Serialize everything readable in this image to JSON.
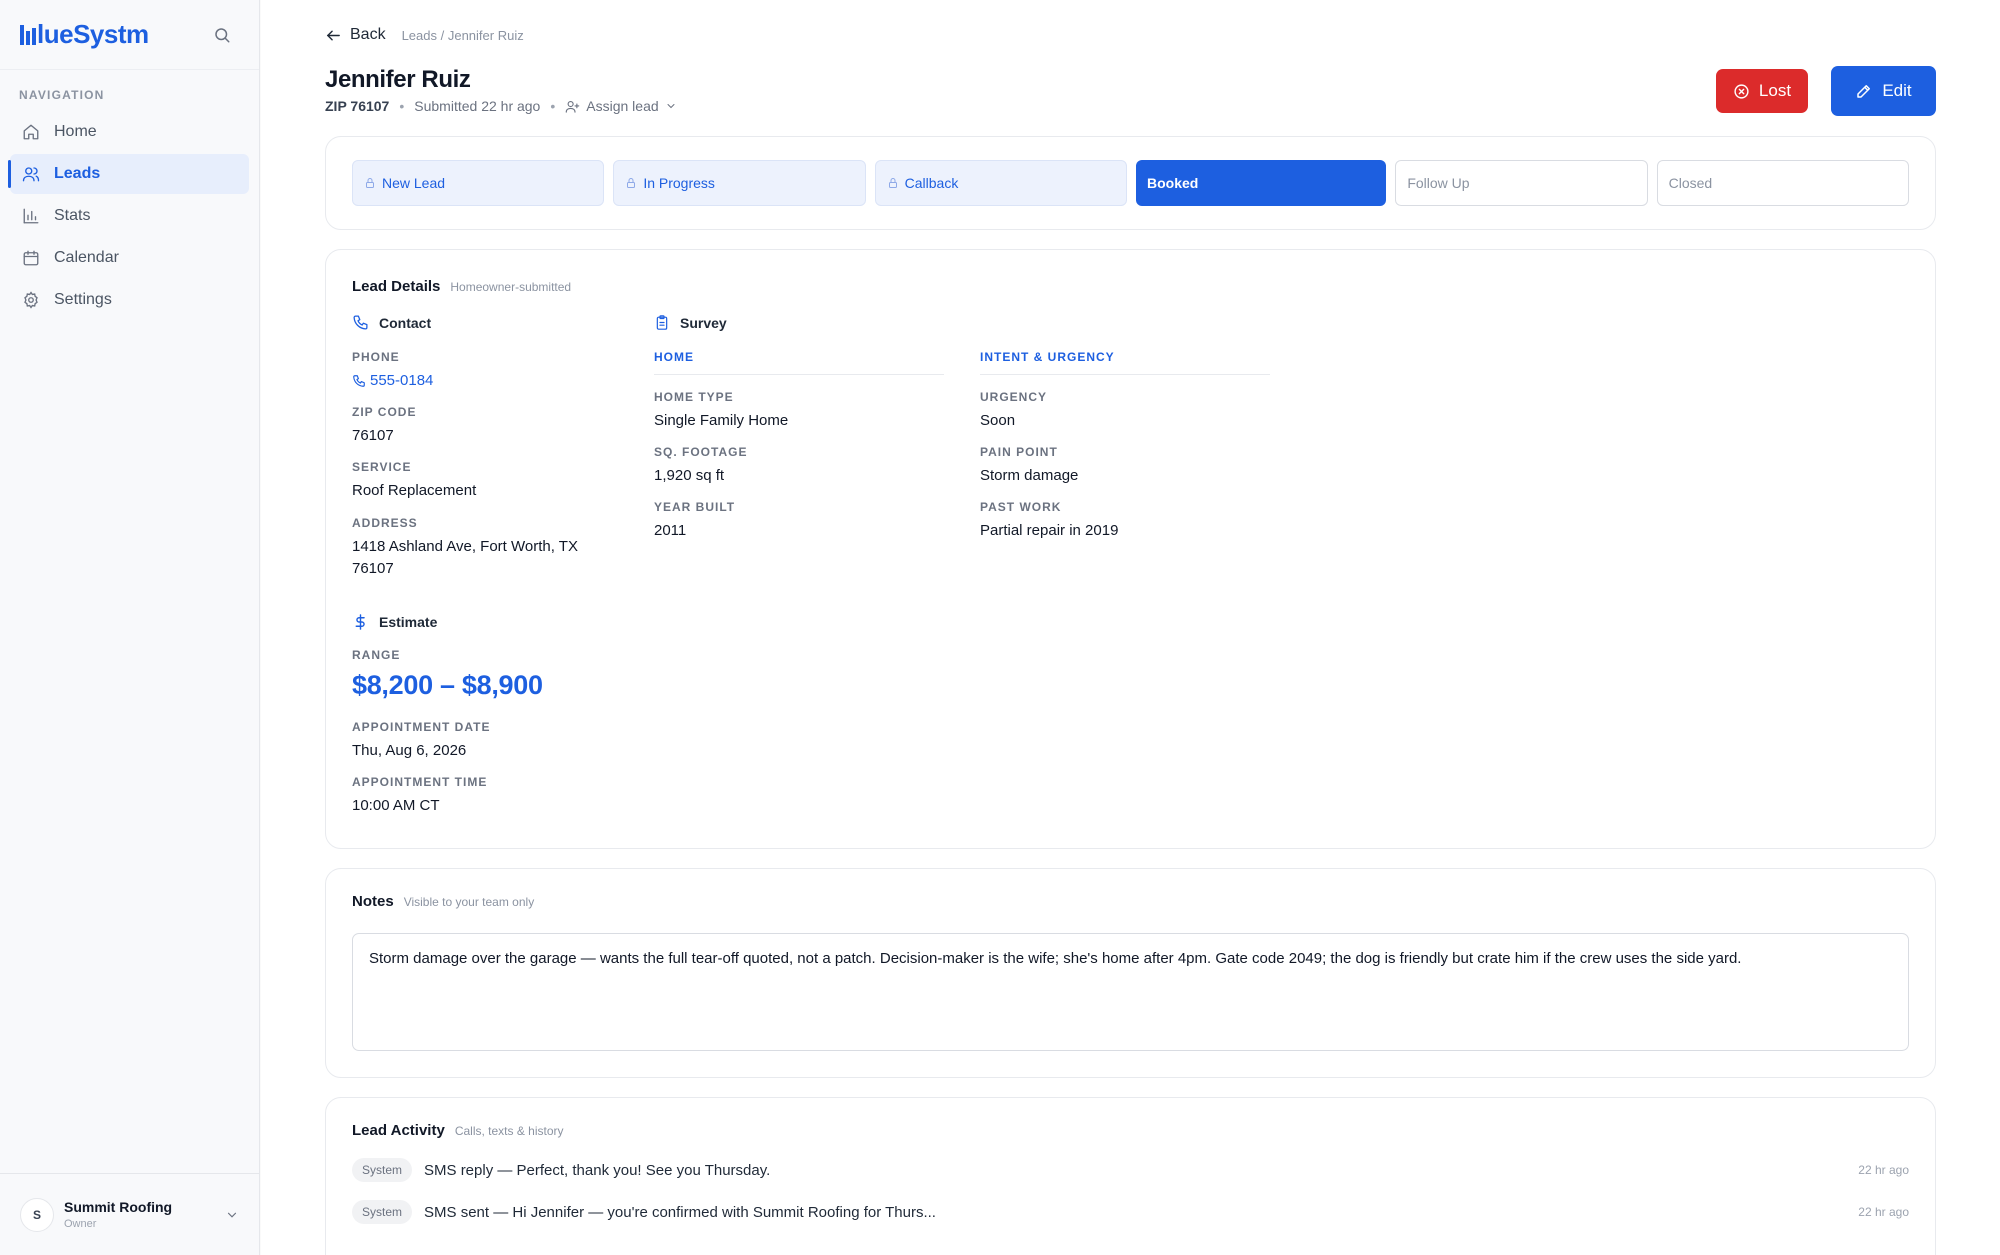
{
  "brand": {
    "name": "lueSystm"
  },
  "sidebar": {
    "heading": "NAVIGATION",
    "items": [
      {
        "label": "Home",
        "icon": "home-icon"
      },
      {
        "label": "Leads",
        "icon": "users-icon",
        "active": true
      },
      {
        "label": "Stats",
        "icon": "bar-chart-icon"
      },
      {
        "label": "Calendar",
        "icon": "calendar-icon"
      },
      {
        "label": "Settings",
        "icon": "gear-icon"
      }
    ],
    "account": {
      "initial": "S",
      "name": "Summit Roofing",
      "role": "Owner"
    }
  },
  "header": {
    "back": "Back",
    "breadcrumb": "Leads / Jennifer Ruiz",
    "name": "Jennifer Ruiz",
    "zip": "ZIP 76107",
    "sep": "•",
    "submitted": "Submitted 22 hr ago",
    "assign": "Assign lead",
    "lost_label": "Lost",
    "edit_label": "Edit"
  },
  "stages": [
    {
      "label": "New Lead",
      "state": "done"
    },
    {
      "label": "In Progress",
      "state": "done"
    },
    {
      "label": "Callback",
      "state": "done"
    },
    {
      "label": "Booked",
      "state": "current"
    },
    {
      "label": "Follow Up",
      "state": "todo"
    },
    {
      "label": "Closed",
      "state": "todo"
    }
  ],
  "details": {
    "title": "Lead Details",
    "subtitle": "Homeowner-submitted",
    "contact": {
      "title": "Contact",
      "phone_label": "PHONE",
      "phone": "555-0184",
      "zip_label": "ZIP CODE",
      "zip": "76107",
      "service_label": "SERVICE",
      "service": "Roof Replacement",
      "address_label": "ADDRESS",
      "address": "1418 Ashland Ave, Fort Worth, TX 76107"
    },
    "survey": {
      "title": "Survey",
      "home_head": "HOME",
      "intent_head": "INTENT & URGENCY",
      "home_type_label": "HOME TYPE",
      "home_type": "Single Family Home",
      "sqft_label": "SQ. FOOTAGE",
      "sqft": "1,920 sq ft",
      "year_label": "YEAR BUILT",
      "year": "2011",
      "urgency_label": "URGENCY",
      "urgency": "Soon",
      "pain_label": "PAIN POINT",
      "pain": "Storm damage",
      "past_label": "PAST WORK",
      "past": "Partial repair in 2019"
    },
    "estimate": {
      "title": "Estimate",
      "range_label": "RANGE",
      "range": "$8,200 – $8,900",
      "date_label": "APPOINTMENT DATE",
      "date": "Thu, Aug 6, 2026",
      "time_label": "APPOINTMENT TIME",
      "time": "10:00 AM CT"
    }
  },
  "notes": {
    "title": "Notes",
    "subtitle": "Visible to your team only",
    "text": "Storm damage over the garage — wants the full tear-off quoted, not a patch. Decision-maker is the wife; she's home after 4pm. Gate code 2049; the dog is friendly but crate him if the crew uses the side yard."
  },
  "activity": {
    "title": "Lead Activity",
    "subtitle": "Calls, texts & history",
    "rows": [
      {
        "tag": "System",
        "text": "SMS reply — Perfect, thank you! See you Thursday.",
        "time": "22 hr ago"
      },
      {
        "tag": "System",
        "text": "SMS sent — Hi Jennifer — you're confirmed with Summit Roofing for Thurs...",
        "time": "22 hr ago"
      }
    ]
  },
  "colors": {
    "accent": "#1d5fe0",
    "danger": "#dc2b2b"
  }
}
